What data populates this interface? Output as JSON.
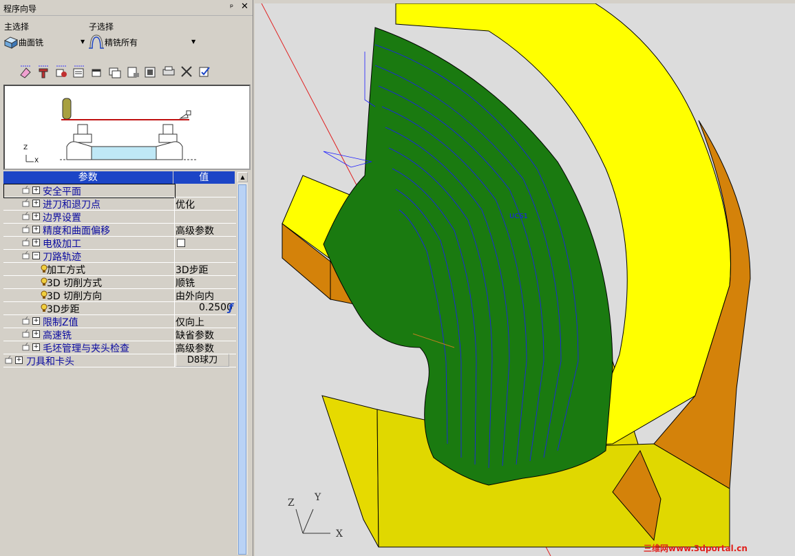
{
  "panel": {
    "title": "程序向导",
    "pin": "ᵖ",
    "close": "✕"
  },
  "main_select": {
    "label": "主选择",
    "value": "曲面铣"
  },
  "sub_select": {
    "label": "子选择",
    "value": "精铣所有"
  },
  "toolbar": {
    "icons": [
      "eraser-icon",
      "tool-icon",
      "tool-list-icon",
      "operation-list-icon",
      "window-icon",
      "window-icon-2",
      "report-icon",
      "data-icon",
      "print-icon",
      "cut-icon",
      "check-icon"
    ]
  },
  "preview": {
    "axis_z": "Z",
    "axis_x": "X"
  },
  "grid": {
    "header_param": "参数",
    "header_value": "值",
    "rows": [
      {
        "label": "安全平面",
        "value": "",
        "level": 1,
        "exp": "+"
      },
      {
        "label": "进刀和退刀点",
        "value": "优化",
        "level": 1,
        "exp": "+"
      },
      {
        "label": "边界设置",
        "value": "",
        "level": 1,
        "exp": "+"
      },
      {
        "label": "精度和曲面偏移",
        "value": "高级参数",
        "level": 1,
        "exp": "+"
      },
      {
        "label": "电极加工",
        "value": "",
        "level": 1,
        "exp": "+"
      },
      {
        "label": "刀路轨迹",
        "value": "",
        "level": 1,
        "exp": "-"
      },
      {
        "label": "加工方式",
        "value": "3D步距",
        "level": 2,
        "exp": ""
      },
      {
        "label": "3D 切削方式",
        "value": "顺铣",
        "level": 2,
        "exp": ""
      },
      {
        "label": "3D 切削方向",
        "value": "由外向内",
        "level": 2,
        "exp": ""
      },
      {
        "label": "3D步距",
        "value": "0.2500",
        "level": 2,
        "exp": ""
      },
      {
        "label": "限制Z值",
        "value": "仅向上",
        "level": 1,
        "exp": "+"
      },
      {
        "label": "高速铣",
        "value": "缺省参数",
        "level": 1,
        "exp": "+"
      },
      {
        "label": "毛坯管理与夹头检查",
        "value": "高级参数",
        "level": 1,
        "exp": "+"
      },
      {
        "label": "刀具和卡头",
        "value": "D8球刀",
        "level": 0,
        "exp": "+"
      }
    ],
    "f_symbol": "ƒ"
  },
  "viewport": {
    "axes": {
      "x": "X",
      "y": "Y",
      "z": "Z"
    },
    "ucs_label": "UCS1"
  },
  "watermark": "三维网www.3dportal.cn",
  "colors": {
    "yellow": "#ffff00",
    "green": "#1a7a10",
    "orange": "#d4820a",
    "toolpath": "#1a1aff",
    "header_blue": "#1c45c6"
  }
}
